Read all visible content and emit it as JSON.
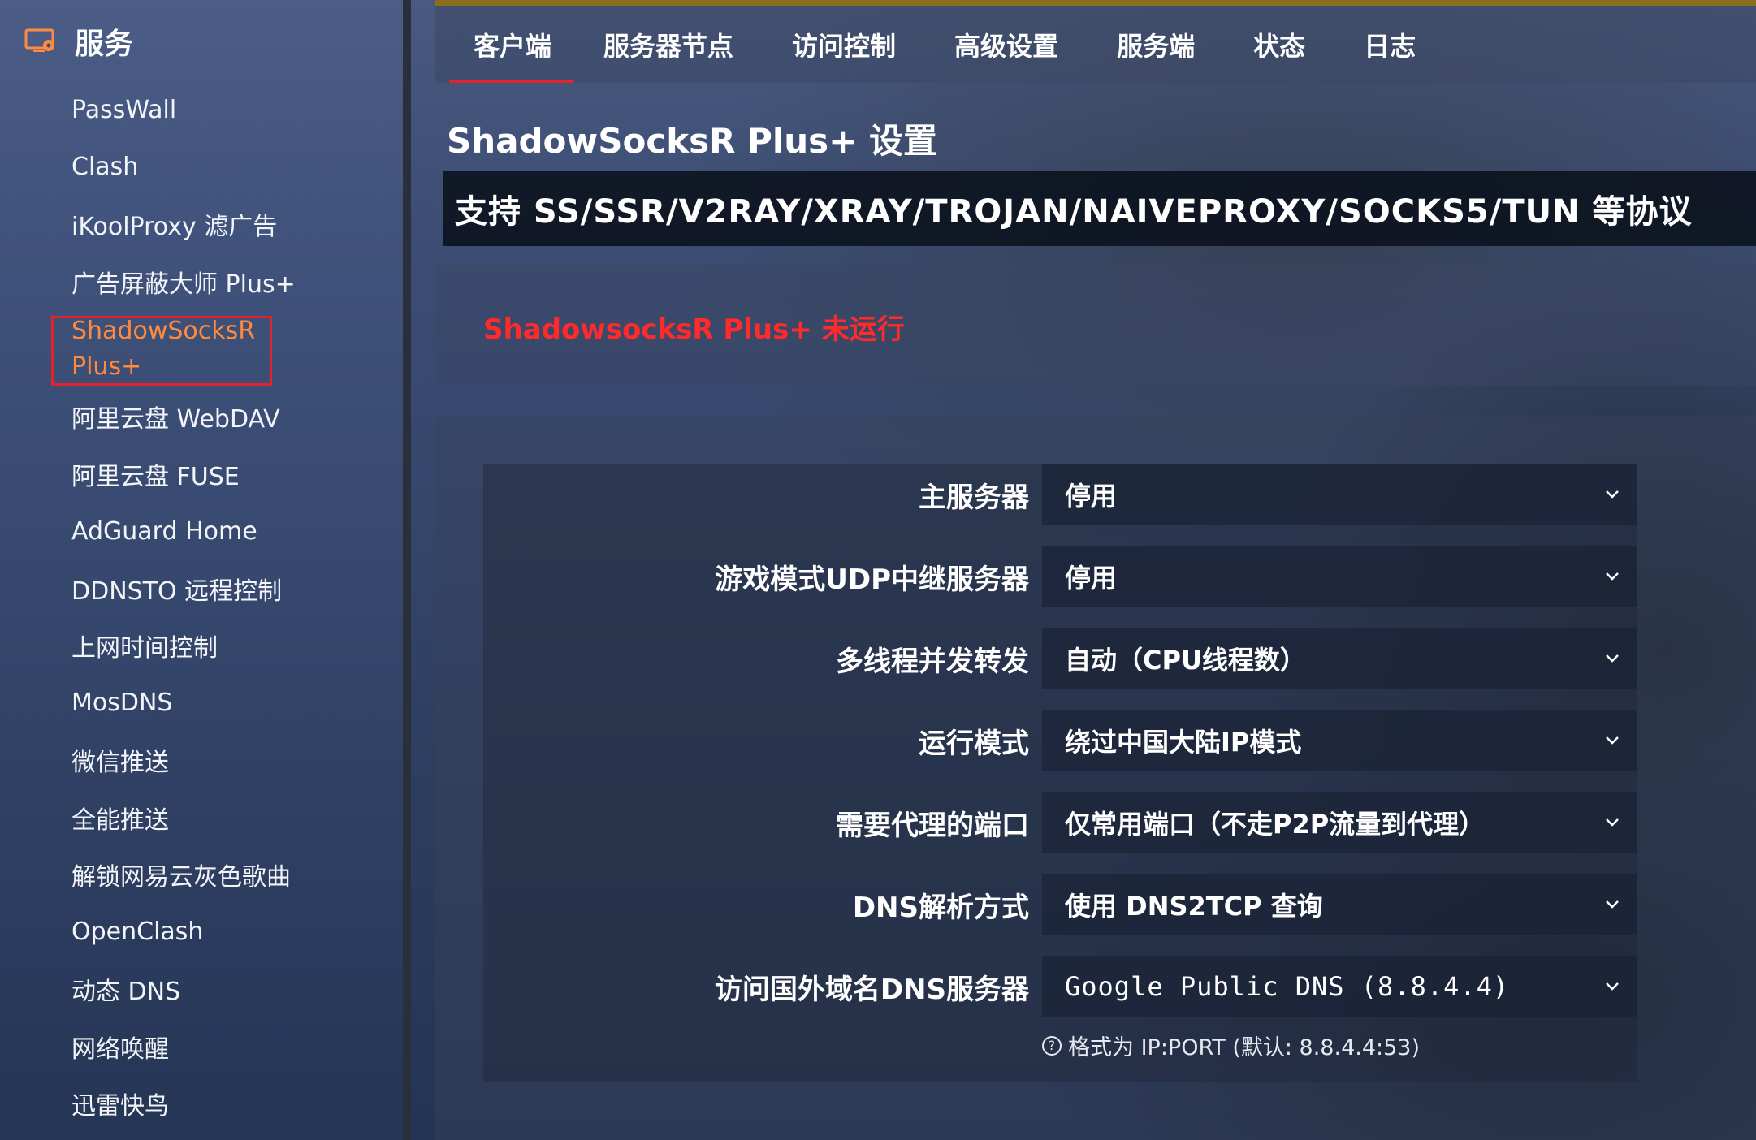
{
  "sidebar": {
    "title": "服务",
    "items": [
      {
        "label": "PassWall"
      },
      {
        "label": "Clash"
      },
      {
        "label": "iKoolProxy 滤广告"
      },
      {
        "label": "广告屏蔽大师 Plus+"
      },
      {
        "label": "ShadowSocksR Plus+",
        "active": true
      },
      {
        "label": "阿里云盘 WebDAV"
      },
      {
        "label": "阿里云盘 FUSE"
      },
      {
        "label": "AdGuard Home"
      },
      {
        "label": "DDNSTO 远程控制"
      },
      {
        "label": "上网时间控制"
      },
      {
        "label": "MosDNS"
      },
      {
        "label": "微信推送"
      },
      {
        "label": "全能推送"
      },
      {
        "label": "解锁网易云灰色歌曲"
      },
      {
        "label": "OpenClash"
      },
      {
        "label": "动态 DNS"
      },
      {
        "label": "网络唤醒"
      },
      {
        "label": "迅雷快鸟"
      }
    ]
  },
  "tabs": [
    {
      "label": "客户端",
      "active": true
    },
    {
      "label": "服务器节点"
    },
    {
      "label": "访问控制"
    },
    {
      "label": "高级设置"
    },
    {
      "label": "服务端"
    },
    {
      "label": "状态"
    },
    {
      "label": "日志"
    }
  ],
  "page": {
    "title": "ShadowSocksR Plus+ 设置",
    "banner": "支持 SS/SSR/V2RAY/XRAY/TROJAN/NAIVEPROXY/SOCKS5/TUN 等协议",
    "status": "ShadowsocksR Plus+ 未运行"
  },
  "settings": [
    {
      "label": "主服务器",
      "value": "停用"
    },
    {
      "label": "游戏模式UDP中继服务器",
      "value": "停用"
    },
    {
      "label": "多线程并发转发",
      "value": "自动（CPU线程数）"
    },
    {
      "label": "运行模式",
      "value": "绕过中国大陆IP模式"
    },
    {
      "label": "需要代理的端口",
      "value": "仅常用端口（不走P2P流量到代理）"
    },
    {
      "label": "DNS解析方式",
      "value": "使用 DNS2TCP 查询"
    },
    {
      "label": "访问国外域名DNS服务器",
      "value": "Google Public DNS (8.8.4.4)"
    }
  ],
  "hint": "格式为 IP:PORT (默认: 8.8.4.4:53)",
  "colors": {
    "accent_red": "#e0242b",
    "status_red": "#ff2a2a",
    "active_orange": "#ff8a3d",
    "top_accent": "#8a6d1e"
  }
}
